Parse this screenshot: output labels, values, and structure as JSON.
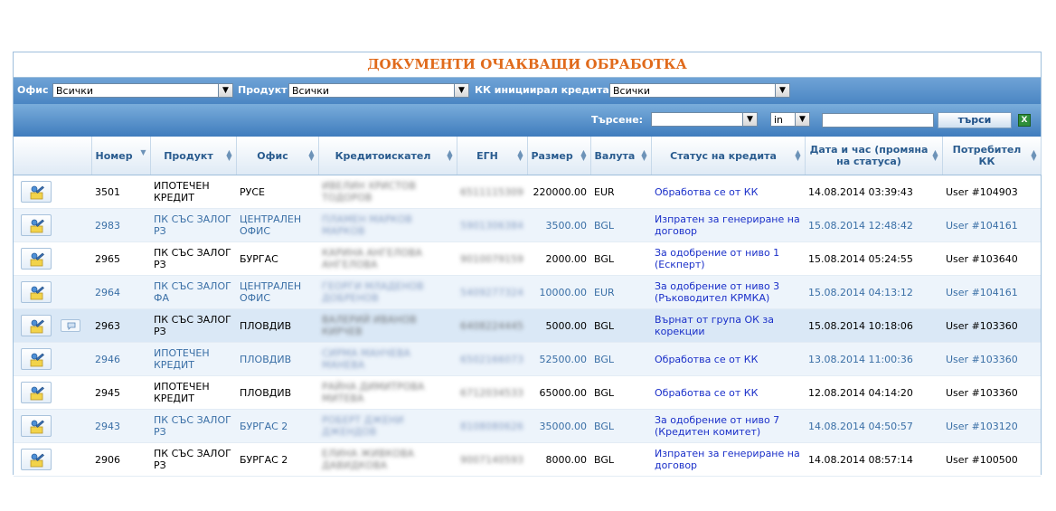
{
  "title": "ДОКУМЕНТИ ОЧАКВАЩИ ОБРАБОТКА",
  "filters": {
    "office_label": "Офис",
    "office_value": "Всички",
    "product_label": "Продукт",
    "product_value": "Всички",
    "kk_label": "КК инициирал кредита",
    "kk_value": "Всички"
  },
  "search": {
    "label": "Търсене:",
    "field_value": "",
    "op_value": "in",
    "text_value": "",
    "button": "търси",
    "export_icon": "excel-export-icon"
  },
  "columns": [
    "Номер",
    "Продукт",
    "Офис",
    "Кредитоискател",
    "ЕГН",
    "Размер",
    "Валута",
    "Статус на кредита",
    "Дата и час (промяна на статуса)",
    "Потребител КК"
  ],
  "rows": [
    {
      "number": "3501",
      "product": "ИПОТЕЧЕН КРЕДИТ",
      "office": "РУСЕ",
      "applicant": "ИВЕЛИН ХРИСТОВ ТОДОРОВ",
      "egn": "6511115309",
      "amount": "220000.00",
      "currency": "EUR",
      "status": "Обработва се от КК",
      "date": "14.08.2014 03:39:43",
      "user": "User #104903"
    },
    {
      "number": "2983",
      "product": "ПК СЪС ЗАЛОГ РЗ",
      "office": "ЦЕНТРАЛЕН ОФИС",
      "applicant": "ПЛАМЕН МАРКОВ МАРКОВ",
      "egn": "5901306384",
      "amount": "3500.00",
      "currency": "BGL",
      "status": "Изпратен за генериране на договор",
      "date": "15.08.2014 12:48:42",
      "user": "User #104161"
    },
    {
      "number": "2965",
      "product": "ПК СЪС ЗАЛОГ РЗ",
      "office": "БУРГАС",
      "applicant": "КАРИНА АНГЕЛОВА АНГЕЛОВА",
      "egn": "9010079159",
      "amount": "2000.00",
      "currency": "BGL",
      "status": "За одобрение от ниво 1 (Ескперт)",
      "date": "15.08.2014 05:24:55",
      "user": "User #103640"
    },
    {
      "number": "2964",
      "product": "ПК СЪС ЗАЛОГ ФА",
      "office": "ЦЕНТРАЛЕН ОФИС",
      "applicant": "ГЕОРГИ МЛАДЕНОВ ДОБРЕНОВ",
      "egn": "5409277324",
      "amount": "10000.00",
      "currency": "EUR",
      "status": "За одобрение от ниво 3 (Ръководител КРМКА)",
      "date": "15.08.2014 04:13:12",
      "user": "User #104161"
    },
    {
      "number": "2963",
      "product": "ПК СЪС ЗАЛОГ РЗ",
      "office": "ПЛОВДИВ",
      "applicant": "ВАЛЕРИЙ ИВАНОВ КИРЧЕВ",
      "egn": "6408224445",
      "amount": "5000.00",
      "currency": "BGL",
      "status": "Върнат от група ОК за корекции",
      "date": "15.08.2014 10:18:06",
      "user": "User #103360"
    },
    {
      "number": "2946",
      "product": "ИПОТЕЧЕН КРЕДИТ",
      "office": "ПЛОВДИВ",
      "applicant": "СИРМА МАНЧЕВА МАНЕВА",
      "egn": "6502166073",
      "amount": "52500.00",
      "currency": "BGL",
      "status": "Обработва се от КК",
      "date": "13.08.2014 11:00:36",
      "user": "User #103360"
    },
    {
      "number": "2945",
      "product": "ИПОТЕЧЕН КРЕДИТ",
      "office": "ПЛОВДИВ",
      "applicant": "РАЙНА ДИМИТРОВА МИТЕВА",
      "egn": "6712034533",
      "amount": "65000.00",
      "currency": "BGL",
      "status": "Обработва се от КК",
      "date": "12.08.2014 04:14:20",
      "user": "User #103360"
    },
    {
      "number": "2943",
      "product": "ПК СЪС ЗАЛОГ РЗ",
      "office": "БУРГАС 2",
      "applicant": "РОБЕРТ ДЖЕНИ ДЖЕНДОВ",
      "egn": "8108080626",
      "amount": "35000.00",
      "currency": "BGL",
      "status": "За одобрение от ниво 7 (Кредитен комитет)",
      "date": "14.08.2014 04:50:57",
      "user": "User #103120"
    },
    {
      "number": "2906",
      "product": "ПК СЪС ЗАЛОГ РЗ",
      "office": "БУРГАС 2",
      "applicant": "ЕЛИНА ЖИВКОВА ДАВИДКОВА",
      "egn": "9007140593",
      "amount": "8000.00",
      "currency": "BGL",
      "status": "Изпратен за генериране на договор",
      "date": "14.08.2014 08:57:14",
      "user": "User #100500"
    }
  ],
  "comment_row": 4,
  "highlight_row": 4
}
